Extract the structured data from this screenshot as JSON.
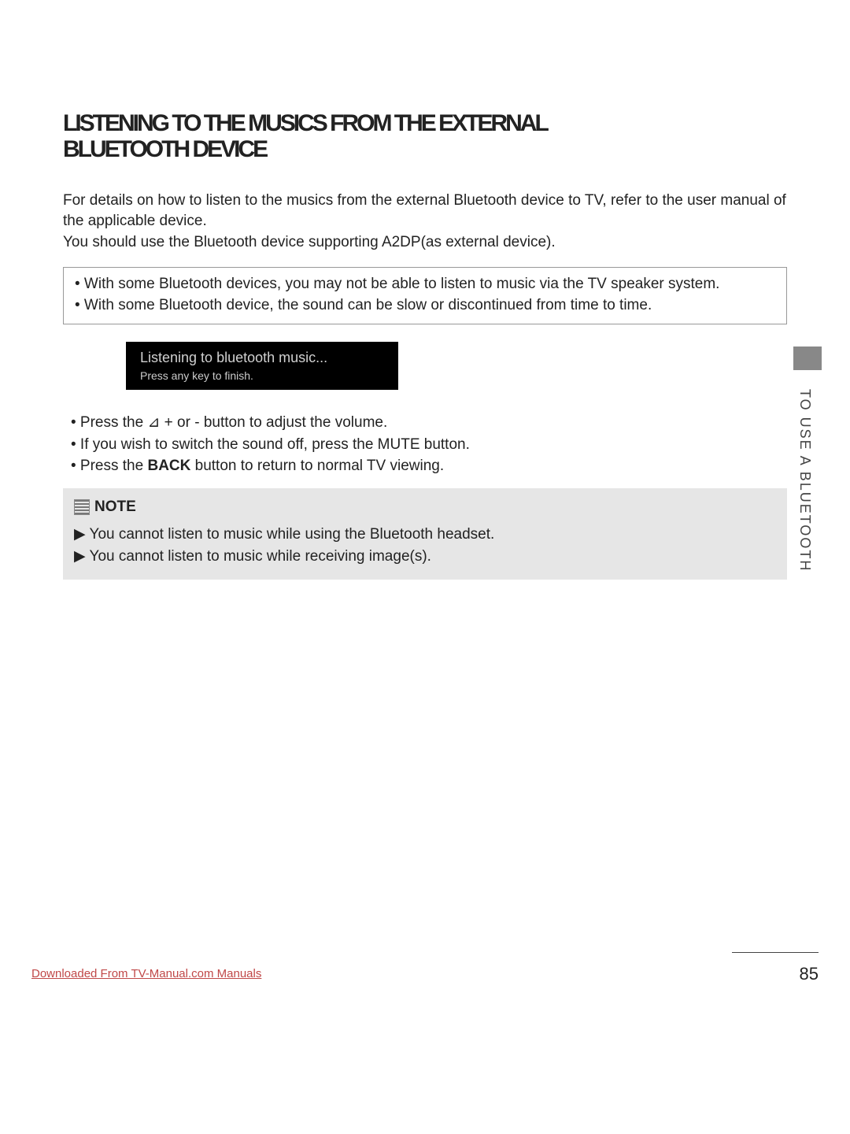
{
  "heading": {
    "line1": "LISTENING TO THE MUSICS FROM THE EXTERNAL",
    "line2": "BLUETOOTH DEVICE"
  },
  "intro": {
    "p1": "For details on how to listen to the musics from the external Bluetooth device to TV, refer to the user manual of the applicable device.",
    "p2": "You should use the Bluetooth device supporting A2DP(as external device)."
  },
  "infobox": {
    "b1": "• With some Bluetooth devices, you may not be able to listen to music via the TV speaker system.",
    "b2": "• With some Bluetooth device, the sound can be slow or discontinued from time to time."
  },
  "blackbox": {
    "line1": "Listening to bluetooth music...",
    "line2": "Press any key to finish."
  },
  "bullets": {
    "b1_pre": "• Press the ",
    "b1_glyph": "⊿",
    "b1_post": " + or -  button to adjust the volume.",
    "b2": "• If you wish to switch the sound off, press the MUTE button.",
    "b3_pre": "• Press the ",
    "b3_key": "BACK",
    "b3_post": " button to return to normal TV viewing."
  },
  "note": {
    "title": "NOTE",
    "n1": "▶ You cannot listen to music while using the Bluetooth headset.",
    "n2": "▶ You cannot listen to music while receiving image(s)."
  },
  "side_label": "TO USE A BLUETOOTH",
  "page_number": "85",
  "footer_link": "Downloaded From TV-Manual.com Manuals"
}
